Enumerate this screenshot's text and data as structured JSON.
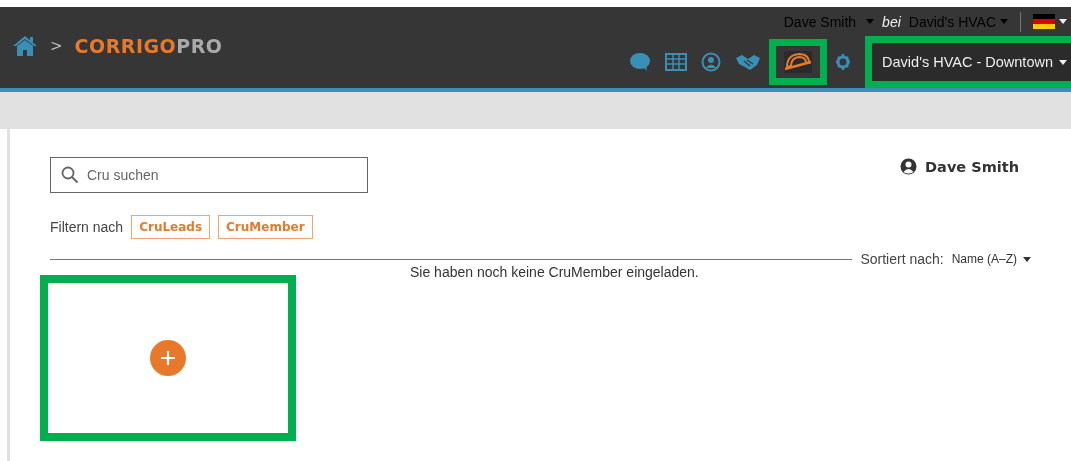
{
  "header": {
    "breadcrumb_separator": ">",
    "logo": {
      "primary": "CORRIGO",
      "secondary": "PRO"
    },
    "account": {
      "user": "Dave Smith",
      "connector": "bei",
      "company": "David's HVAC"
    },
    "toolbar_icons": [
      {
        "kind": "chat",
        "selected": false,
        "highlighted": false
      },
      {
        "kind": "table",
        "selected": false,
        "highlighted": false
      },
      {
        "kind": "person",
        "selected": false,
        "highlighted": false
      },
      {
        "kind": "handshake",
        "selected": false,
        "highlighted": false
      },
      {
        "kind": "hardhat",
        "selected": true,
        "highlighted": true
      },
      {
        "kind": "gear",
        "selected": false,
        "highlighted": false
      }
    ],
    "location": {
      "value": "David's HVAC - Downtown",
      "highlighted": true
    }
  },
  "content": {
    "search": {
      "placeholder": "Cru suchen"
    },
    "profile_name": "Dave Smith",
    "filter_label": "Filtern nach",
    "filters": [
      {
        "label": "CruLeads",
        "selected": false
      },
      {
        "label": "CruMember",
        "selected": false
      }
    ],
    "sort_label": "Sortiert nach:",
    "sort_value": "Name (A–Z)",
    "empty_message": "Sie haben noch keine CruMember eingeladen.",
    "add_card": {
      "highlighted": true
    }
  }
}
